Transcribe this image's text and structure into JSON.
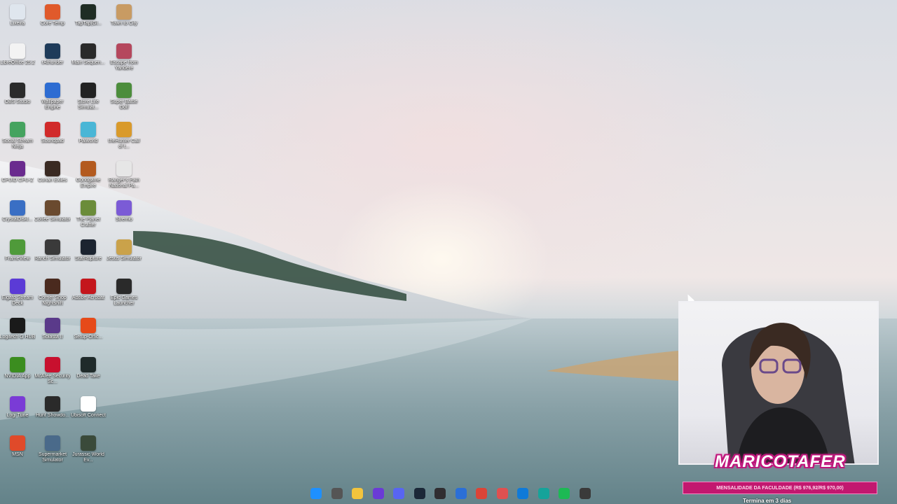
{
  "desktop": {
    "icons": [
      {
        "label": "Lixeira",
        "icon": "recycle-bin-icon",
        "color": "#dfe6ee"
      },
      {
        "label": "Core Temp",
        "icon": "core-temp-icon",
        "color": "#e05a2b"
      },
      {
        "label": "TapTap(Gl...",
        "icon": "taptap-icon",
        "color": "#1f2d24"
      },
      {
        "label": "Town to City",
        "icon": "town-to-city-icon",
        "color": "#c89b63"
      },
      {
        "label": "LibreOffice 25.2",
        "icon": "libreoffice-icon",
        "color": "#f3f3f3"
      },
      {
        "label": "rAthunder",
        "icon": "r-app-icon",
        "color": "#1e3b5a"
      },
      {
        "label": "Main Sequen...",
        "icon": "main-sequence-icon",
        "color": "#2a2a2a"
      },
      {
        "label": "Escape from Yandere",
        "icon": "escape-yandere-icon",
        "color": "#b5475d"
      },
      {
        "label": "OBS Studio",
        "icon": "obs-icon",
        "color": "#2b2b2b"
      },
      {
        "label": "Wallpaper Engine",
        "icon": "wallpaper-engine-icon",
        "color": "#2d6cd2"
      },
      {
        "label": "Store Life Simulat...",
        "icon": "store-life-icon",
        "color": "#222222"
      },
      {
        "label": "Super Battle Golf",
        "icon": "battle-golf-icon",
        "color": "#4c8d3c"
      },
      {
        "label": "Social Stream Ninja",
        "icon": "social-stream-icon",
        "color": "#45a35f"
      },
      {
        "label": "Soundpad",
        "icon": "soundpad-icon",
        "color": "#d12a2a"
      },
      {
        "label": "Palworld",
        "icon": "palworld-icon",
        "color": "#4ab6d6"
      },
      {
        "label": "theHunter Call of t...",
        "icon": "thehunter-icon",
        "color": "#d99a2b"
      },
      {
        "label": "CPUID CPU-Z",
        "icon": "cpuz-icon",
        "color": "#6a2b8e"
      },
      {
        "label": "Conan Exiles",
        "icon": "conan-icon",
        "color": "#3a2a22"
      },
      {
        "label": "Goodgame Empire",
        "icon": "goodgame-icon",
        "color": "#b35a1f"
      },
      {
        "label": "Ranger's Path National Pa...",
        "icon": "rangers-path-icon",
        "color": "#e6e6e6"
      },
      {
        "label": "CrystalDiskI...",
        "icon": "crystaldisk-icon",
        "color": "#3a6fc4"
      },
      {
        "label": "Coffee Simulator",
        "icon": "coffee-sim-icon",
        "color": "#6a4a2f"
      },
      {
        "label": "The Planet Crafter",
        "icon": "planet-crafter-icon",
        "color": "#6b8c3a"
      },
      {
        "label": "Stremio",
        "icon": "stremio-icon",
        "color": "#7b5bd6"
      },
      {
        "label": "FrameView",
        "icon": "frameview-icon",
        "color": "#4f9a3a"
      },
      {
        "label": "Ranch Simulator",
        "icon": "ranch-sim-icon",
        "color": "#3a3a3a"
      },
      {
        "label": "StarRupture",
        "icon": "starrupture-icon",
        "color": "#1c2430"
      },
      {
        "label": "Jesus Simulator",
        "icon": "jesus-sim-icon",
        "color": "#caa24a"
      },
      {
        "label": "Elgato Stream Deck",
        "icon": "stream-deck-icon",
        "color": "#5b3bd6"
      },
      {
        "label": "Corner Shop Nightshift",
        "icon": "corner-shop-icon",
        "color": "#4a2a1e"
      },
      {
        "label": "Adobe Acrobat",
        "icon": "acrobat-icon",
        "color": "#c4161c"
      },
      {
        "label": "Epic Games Launcher",
        "icon": "epic-games-icon",
        "color": "#2a2a2a"
      },
      {
        "label": "Logitech G HUB",
        "icon": "logitech-icon",
        "color": "#1a1a1a"
      },
      {
        "label": "Solasta II",
        "icon": "solasta-icon",
        "color": "#5a3a8a"
      },
      {
        "label": "Setup-Offic...",
        "icon": "office-setup-icon",
        "color": "#e64a19"
      },
      {
        "label": "NVIDIA App",
        "icon": "nvidia-icon",
        "color": "#3b8d1f"
      },
      {
        "label": "McAfee Security Sc...",
        "icon": "mcafee-icon",
        "color": "#c8102e"
      },
      {
        "label": "Dead Take",
        "icon": "dead-take-icon",
        "color": "#1f2a2a"
      },
      {
        "label": "Logi Tune",
        "icon": "logi-tune-icon",
        "color": "#7a3bd6"
      },
      {
        "label": "Hunt Showdo...",
        "icon": "hunt-showdown-icon",
        "color": "#2a2a2a"
      },
      {
        "label": "Ubisoft Connect",
        "icon": "ubisoft-icon",
        "color": "#ffffff"
      },
      {
        "label": "MSN",
        "icon": "msn-icon",
        "color": "#e04a2a"
      },
      {
        "label": "Supermarket Simulator",
        "icon": "supermarket-sim-icon",
        "color": "#4a6a8a"
      },
      {
        "label": "Jurassic World Ev...",
        "icon": "jurassic-icon",
        "color": "#3a4a3a"
      }
    ]
  },
  "overlay": {
    "streamer_name": "MARICOTAFER",
    "goal_text": "MENSALIDADE DA FACULDADE (R$ 976,92/R$ 970,00)",
    "goal_subtext": "Termina em 3 dias"
  },
  "taskbar": {
    "buttons": [
      {
        "icon": "windows-start-icon",
        "color": "#1e90ff",
        "interactive": true
      },
      {
        "icon": "task-view-icon",
        "color": "#555555",
        "interactive": true
      },
      {
        "icon": "file-explorer-icon",
        "color": "#f2c43d",
        "interactive": true
      },
      {
        "icon": "app-grid-icon",
        "color": "#6a3bd6",
        "interactive": true
      },
      {
        "icon": "discord-icon",
        "color": "#5865f2",
        "interactive": true
      },
      {
        "icon": "steam-icon",
        "color": "#1b2838",
        "interactive": true
      },
      {
        "icon": "obs-taskbar-icon",
        "color": "#302e31",
        "interactive": true
      },
      {
        "icon": "streamerbot-icon",
        "color": "#2b6fd6",
        "interactive": true
      },
      {
        "icon": "chrome-icon",
        "color": "#db4437",
        "interactive": true
      },
      {
        "icon": "target-app-icon",
        "color": "#e05050",
        "interactive": true
      },
      {
        "icon": "edge-icon",
        "color": "#0f7ad8",
        "interactive": true
      },
      {
        "icon": "app-c-icon",
        "color": "#16a39a",
        "interactive": true
      },
      {
        "icon": "spotify-icon",
        "color": "#1db954",
        "interactive": true
      },
      {
        "icon": "steam-notify-icon",
        "color": "#3a3a3a",
        "interactive": true
      }
    ]
  }
}
